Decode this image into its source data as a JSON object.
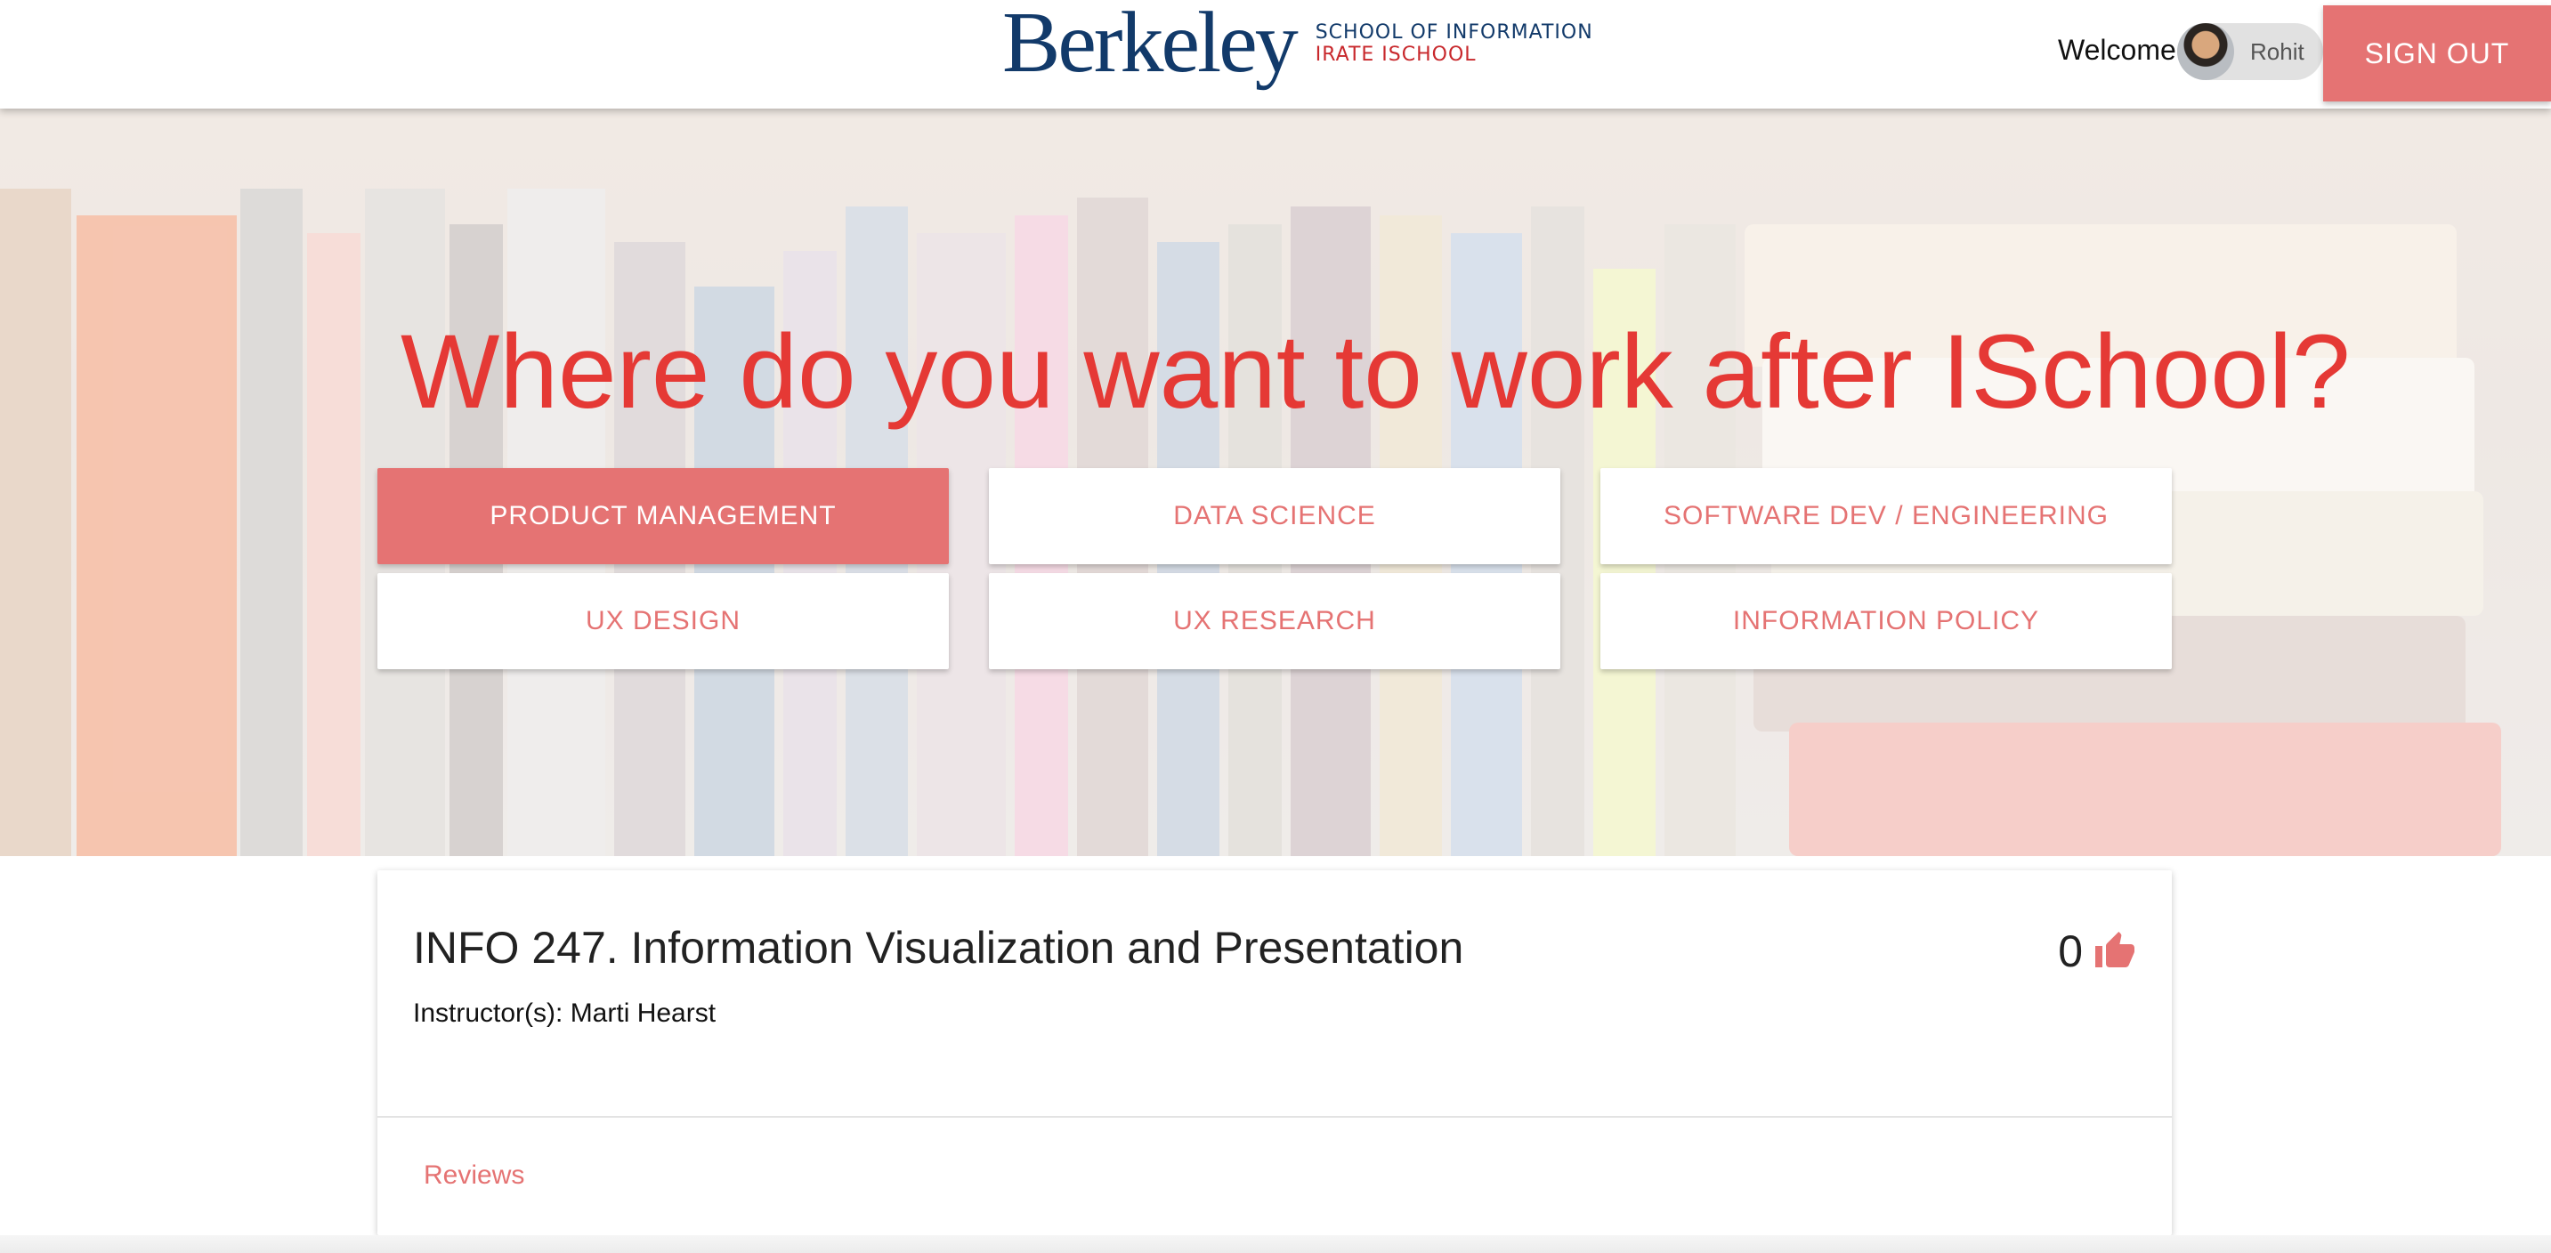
{
  "header": {
    "logo": {
      "word": "Berkeley",
      "line1": "SCHOOL OF INFORMATION",
      "line2": "IRATE ISCHOOL"
    },
    "welcome": "Welcome",
    "user_name": "Rohit",
    "sign_out_label": "SIGN OUT"
  },
  "hero": {
    "title": "Where do you want to work after ISchool?",
    "categories": [
      {
        "label": "PRODUCT MANAGEMENT",
        "active": true
      },
      {
        "label": "DATA SCIENCE",
        "active": false
      },
      {
        "label": "SOFTWARE DEV / ENGINEERING",
        "active": false
      },
      {
        "label": "UX DESIGN",
        "active": false
      },
      {
        "label": "UX RESEARCH",
        "active": false
      },
      {
        "label": "INFORMATION POLICY",
        "active": false
      }
    ]
  },
  "course": {
    "title": "INFO 247. Information Visualization and Presentation",
    "instructor": "Instructor(s): Marti Hearst",
    "votes": "0",
    "reviews_label": "Reviews"
  },
  "colors": {
    "accent": "#e57373",
    "title_red": "#e53935",
    "brand_navy": "#123a6a",
    "brand_red": "#c8282c"
  },
  "icons": {
    "vote": "thumbs-up-icon"
  }
}
